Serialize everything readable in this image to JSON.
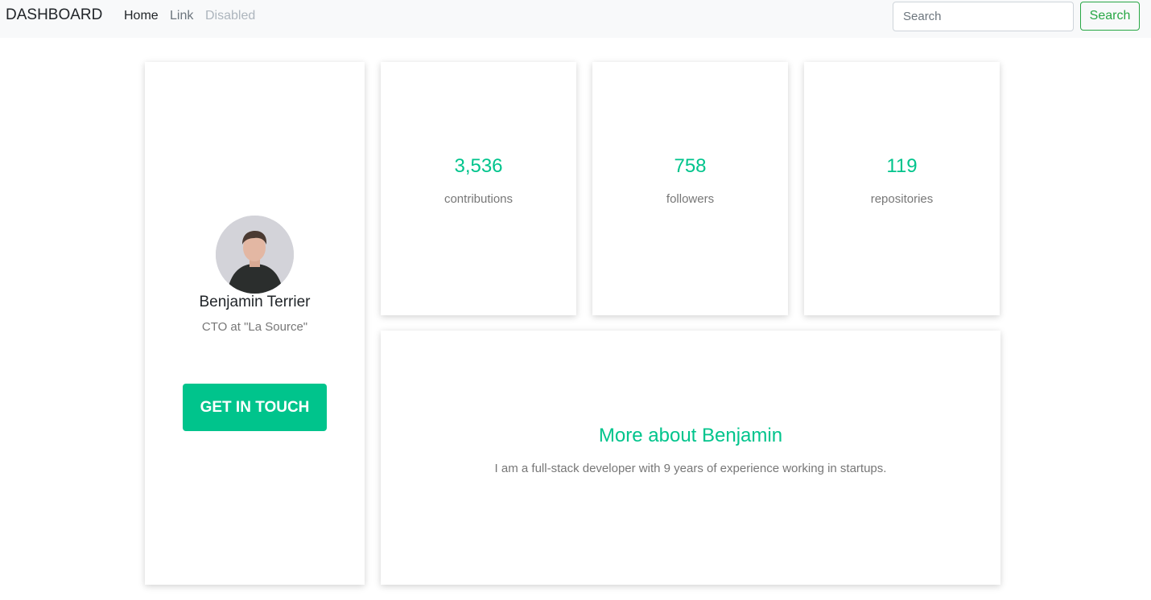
{
  "navbar": {
    "brand": "DASHBOARD",
    "links": [
      {
        "label": "Home",
        "state": "active"
      },
      {
        "label": "Link",
        "state": "normal"
      },
      {
        "label": "Disabled",
        "state": "disabled"
      }
    ],
    "search": {
      "placeholder": "Search",
      "value": "",
      "button_label": "Search"
    }
  },
  "profile": {
    "name": "Benjamin Terrier",
    "role": "CTO at \"La Source\"",
    "cta_label": "GET IN TOUCH"
  },
  "stats": [
    {
      "value": "3,536",
      "label": "contributions"
    },
    {
      "value": "758",
      "label": "followers"
    },
    {
      "value": "119",
      "label": "repositories"
    }
  ],
  "about": {
    "title": "More about Benjamin",
    "text": "I am a full-stack developer with 9 years of experience working in startups."
  },
  "colors": {
    "accent": "#00c48c",
    "search_button": "#28a745",
    "navbar_bg": "#f8f9fa",
    "muted_text": "#777777"
  }
}
